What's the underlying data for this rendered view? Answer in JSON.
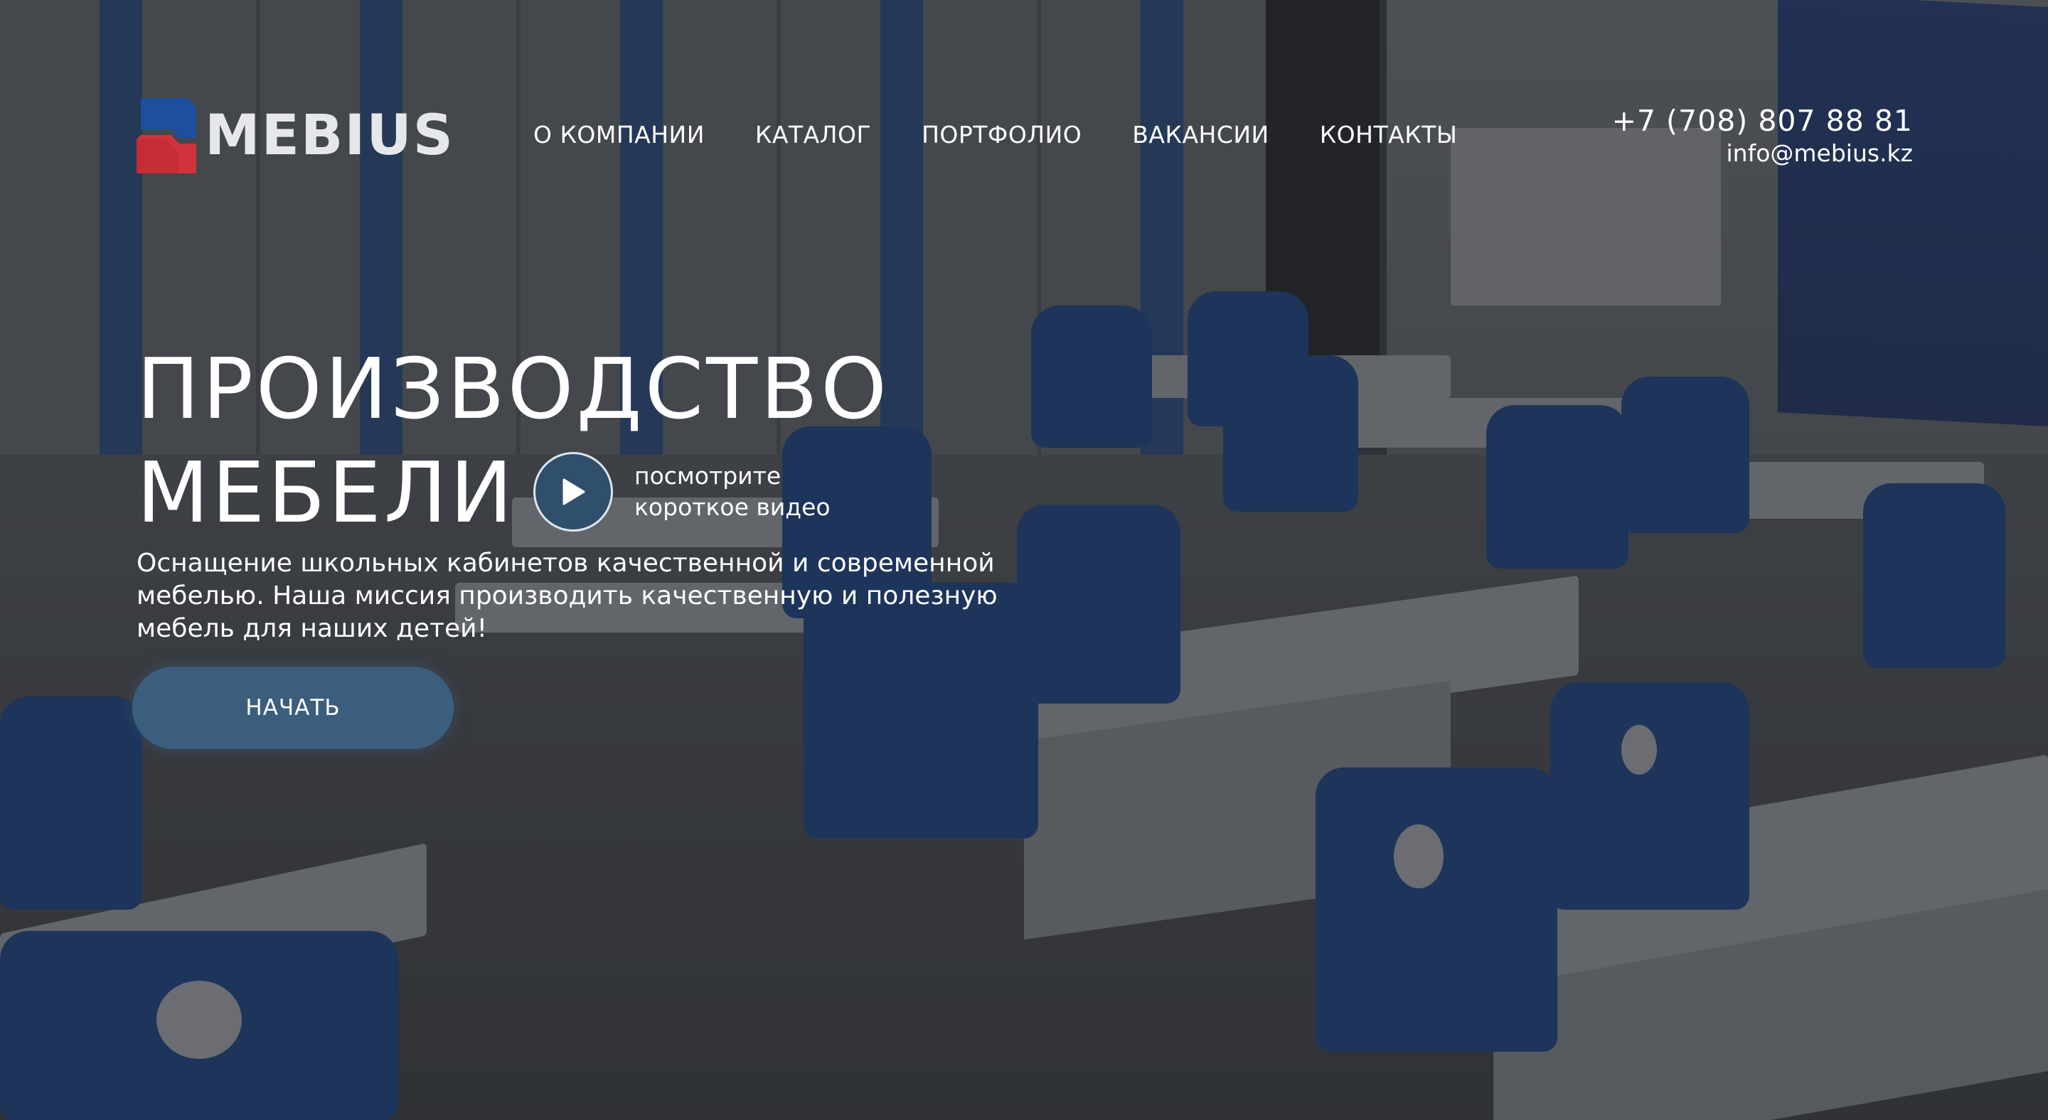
{
  "header": {
    "logo_text": "MEBIUS",
    "nav": [
      {
        "label": "О КОМПАНИИ"
      },
      {
        "label": "КАТАЛОГ"
      },
      {
        "label": "ПОРТФОЛИО"
      },
      {
        "label": "ВАКАНСИИ"
      },
      {
        "label": "КОНТАКТЫ"
      }
    ],
    "phone": "+7 (708) 807 88 81",
    "email": "info@mebius.kz"
  },
  "hero": {
    "title_line1": "ПРОИЗВОДСТВО",
    "title_line2": "МЕБЕЛИ",
    "video_line1": "посмотрите",
    "video_line2": "короткое видео",
    "description": "Оснащение школьных кабинетов качественной и современной мебелью. Наша миссия производить качественную и полезную мебель для наших детей!",
    "cta_label": "НАЧАТЬ"
  },
  "colors": {
    "accent": "#3c5e7e",
    "logo_blue": "#1f4f9c",
    "logo_red": "#d2323c",
    "text": "#ffffff"
  },
  "icons": {
    "play": "play-icon",
    "logo": "mebius-logo-mark"
  }
}
